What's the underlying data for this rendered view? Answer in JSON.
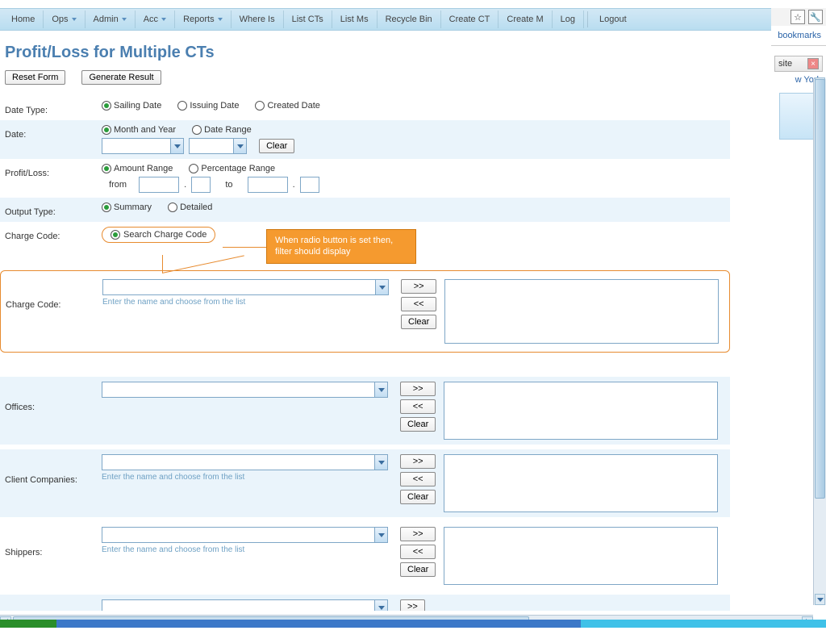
{
  "nav": {
    "items": [
      {
        "label": "Home",
        "dropdown": false
      },
      {
        "label": "Ops",
        "dropdown": true
      },
      {
        "label": "Admin",
        "dropdown": true
      },
      {
        "label": "Acc",
        "dropdown": true
      },
      {
        "label": "Reports",
        "dropdown": true
      },
      {
        "label": "Where Is",
        "dropdown": false
      },
      {
        "label": "List CTs",
        "dropdown": false
      },
      {
        "label": "List Ms",
        "dropdown": false
      },
      {
        "label": "Recycle Bin",
        "dropdown": false
      },
      {
        "label": "Create CT",
        "dropdown": false
      },
      {
        "label": "Create M",
        "dropdown": false
      },
      {
        "label": "Log",
        "dropdown": false
      },
      {
        "label": "Logout",
        "dropdown": false
      }
    ]
  },
  "page": {
    "title": "Profit/Loss for Multiple CTs"
  },
  "buttons": {
    "reset": "Reset Form",
    "generate": "Generate Result",
    "clear": "Clear",
    "add": ">>",
    "remove": "<<"
  },
  "labels": {
    "date_type": "Date Type:",
    "date": "Date:",
    "profit_loss": "Profit/Loss:",
    "output_type": "Output Type:",
    "charge_code": "Charge Code:",
    "offices": "Offices:",
    "client_companies": "Client Companies:",
    "shippers": "Shippers:",
    "from": "from",
    "to": "to"
  },
  "radios": {
    "date_type": {
      "sailing": "Sailing Date",
      "issuing": "Issuing Date",
      "created": "Created Date"
    },
    "date_mode": {
      "month_year": "Month and Year",
      "range": "Date Range"
    },
    "pl_mode": {
      "amount": "Amount Range",
      "percent": "Percentage Range"
    },
    "output": {
      "summary": "Summary",
      "detailed": "Detailed"
    },
    "charge": {
      "search": "Search Charge Code"
    }
  },
  "hints": {
    "enter_choose": "Enter the name and choose from the list"
  },
  "callout": {
    "text": "When radio button is set then, filter should display"
  },
  "right": {
    "bookmarks": "bookmarks",
    "tab": "site",
    "ny": "w York"
  }
}
